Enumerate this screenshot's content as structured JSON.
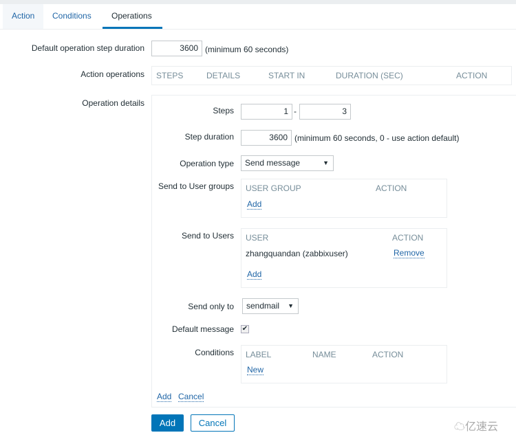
{
  "tabs": [
    {
      "label": "Action"
    },
    {
      "label": "Conditions"
    },
    {
      "label": "Operations"
    }
  ],
  "form": {
    "default_step_duration_label": "Default operation step duration",
    "default_step_duration_value": "3600",
    "default_step_duration_hint": "(minimum 60 seconds)",
    "action_operations_label": "Action operations",
    "action_operations_headers": [
      "STEPS",
      "DETAILS",
      "START IN",
      "DURATION (SEC)",
      "ACTION"
    ],
    "operation_details_label": "Operation details"
  },
  "details": {
    "steps_label": "Steps",
    "steps_from": "1",
    "steps_to": "3",
    "steps_sep": "-",
    "step_duration_label": "Step duration",
    "step_duration_value": "3600",
    "step_duration_hint": "(minimum 60 seconds, 0 - use action default)",
    "operation_type_label": "Operation type",
    "operation_type_value": "Send message",
    "user_groups_label": "Send to User groups",
    "user_groups_headers": [
      "USER GROUP",
      "ACTION"
    ],
    "user_groups_add": "Add",
    "users_label": "Send to Users",
    "users_headers": [
      "USER",
      "ACTION"
    ],
    "users": [
      {
        "name": "zhangquandan (zabbixuser)",
        "action": "Remove"
      }
    ],
    "users_add": "Add",
    "send_only_to_label": "Send only to",
    "send_only_to_value": "sendmail",
    "default_message_label": "Default message",
    "default_message_checked": true,
    "conditions_label": "Conditions",
    "conditions_headers": [
      "LABEL",
      "NAME",
      "ACTION"
    ],
    "conditions_new": "New",
    "add_link": "Add",
    "cancel_link": "Cancel"
  },
  "buttons": {
    "add": "Add",
    "cancel": "Cancel"
  },
  "watermark": "亿速云",
  "colors": {
    "accent": "#0275b8",
    "link": "#1f65a6"
  }
}
